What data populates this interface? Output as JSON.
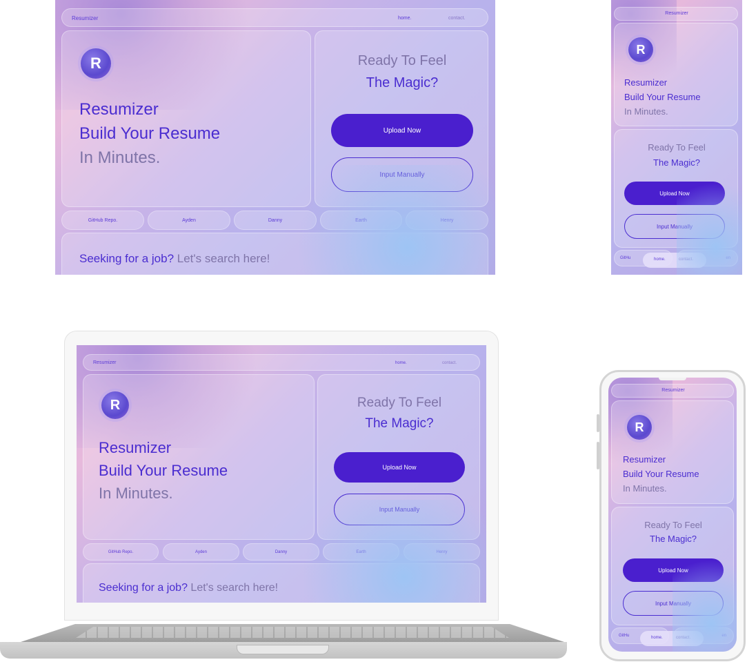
{
  "app": {
    "brand": "Resumizer",
    "nav": {
      "home": "home.",
      "contact": "contact."
    },
    "hero": {
      "logo_letter": "R",
      "line1": "Resumizer",
      "line2": "Build Your Resume",
      "line3": "In Minutes."
    },
    "cta": {
      "line1": "Ready To Feel",
      "line2": "The Magic?",
      "upload_label": "Upload Now",
      "manual_label": "Input Manually"
    },
    "pills": [
      "GitHub Repo.",
      "Ayden",
      "Danny",
      "Earth",
      "Henry"
    ],
    "pills_short": {
      "left": "GitHu",
      "right": "en"
    },
    "search": {
      "prompt_bold": "Seeking for a job?",
      "prompt_rest": " Let's search here!"
    }
  },
  "colors": {
    "accent": "#4a1fce",
    "text_purple": "#4a2dd0",
    "text_gray": "#7f74a8"
  }
}
